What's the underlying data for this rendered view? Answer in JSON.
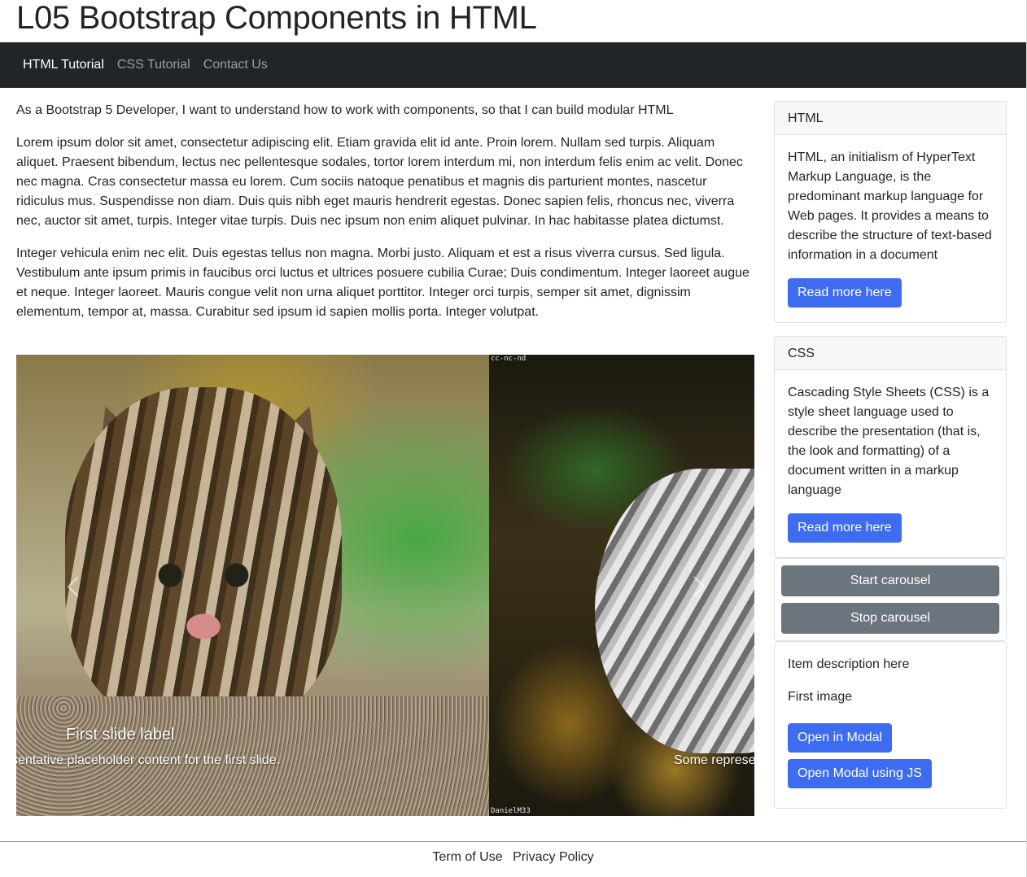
{
  "page": {
    "title": "L05 Bootstrap Components in HTML"
  },
  "nav": {
    "items": [
      {
        "label": "HTML Tutorial",
        "active": true
      },
      {
        "label": "CSS Tutorial",
        "active": false
      },
      {
        "label": "Contact Us",
        "active": false
      }
    ]
  },
  "main": {
    "intro": "As a Bootstrap 5 Developer, I want to understand how to work with components, so that I can build modular HTML",
    "para1": "Lorem ipsum dolor sit amet, consectetur adipiscing elit. Etiam gravida elit id ante. Proin lorem. Nullam sed turpis. Aliquam aliquet. Praesent bibendum, lectus nec pellentesque sodales, tortor lorem interdum mi, non interdum felis enim ac velit. Donec nec magna. Cras consectetur massa eu lorem. Cum sociis natoque penatibus et magnis dis parturient montes, nascetur ridiculus mus. Suspendisse non diam. Duis quis nibh eget mauris hendrerit egestas. Donec sapien felis, rhoncus nec, viverra nec, auctor sit amet, turpis. Integer vitae turpis. Duis nec ipsum non enim aliquet pulvinar. In hac habitasse platea dictumst.",
    "para2": "Integer vehicula enim nec elit. Duis egestas tellus non magna. Morbi justo. Aliquam et est a risus viverra cursus. Sed ligula. Vestibulum ante ipsum primis in faucibus orci luctus et ultrices posuere cubilia Curae; Duis condimentum. Integer laoreet augue et neque. Integer laoreet. Mauris congue velit non urna aliquet porttitor. Integer orci turpis, semper sit amet, dignissim elementum, tempor at, massa. Curabitur sed ipsum id sapien mollis porta. Integer volutpat."
  },
  "carousel": {
    "slide1": {
      "caption_title": "First slide label",
      "caption_text": "sentative placeholder content for the first slide."
    },
    "slide2": {
      "caption_text": "Some represe",
      "watermark_top": "cc-nc-nd",
      "watermark_bottom": "DanielM33"
    },
    "prev_icon": "chevron-left-icon",
    "next_icon": "chevron-right-icon"
  },
  "sidebar": {
    "html_card": {
      "header": "HTML",
      "body": "HTML, an initialism of HyperText Markup Language, is the predominant markup language for Web pages. It provides a means to describe the structure of text-based information in a document",
      "button": "Read more here"
    },
    "css_card": {
      "header": "CSS",
      "body": "Cascading Style Sheets (CSS) is a style sheet language used to describe the presentation (that is, the look and formatting) of a document written in a markup language",
      "button": "Read more here"
    },
    "controls": {
      "start": "Start carousel",
      "stop": "Stop carousel"
    },
    "item": {
      "description": "Item description here",
      "image_name": "First image",
      "open_modal": "Open in Modal",
      "open_modal_js": "Open Modal using JS"
    }
  },
  "footer": {
    "terms": "Term of Use",
    "privacy": "Privacy Policy"
  },
  "colors": {
    "navbar": "#212529",
    "primary": "#3d6cf0",
    "secondary": "#6c757d"
  }
}
